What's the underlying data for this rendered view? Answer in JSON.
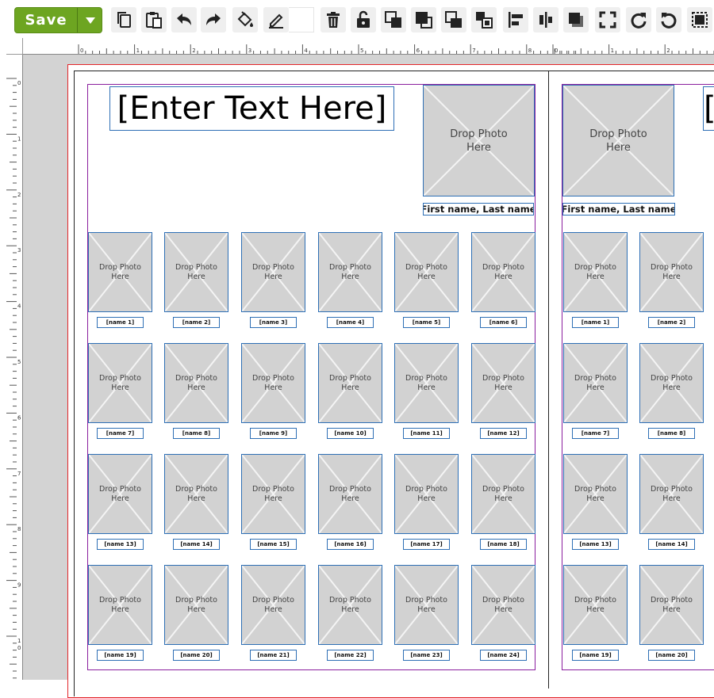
{
  "toolbar": {
    "save_label": "Save",
    "accent": "#6da521",
    "icons": [
      "copy-icon",
      "paste-icon",
      "undo-icon",
      "redo-icon",
      "fill-bucket-icon",
      "pen-icon",
      "delete-icon",
      "unlock-icon",
      "bring-forward-icon",
      "bring-to-front-icon",
      "send-backward-icon",
      "send-to-back-icon",
      "align-left-icon",
      "align-center-icon",
      "shadow-icon",
      "fit-frame-icon",
      "rotate-right-icon",
      "rotate-left-icon",
      "crop-icon"
    ]
  },
  "ruler": {
    "top_left_page": [
      "0",
      "1",
      "2",
      "3",
      "4",
      "5",
      "6",
      "7",
      "8"
    ],
    "top_right_page": [
      "0",
      "1",
      "2"
    ],
    "left": [
      "0",
      "1",
      "2",
      "3",
      "4",
      "5",
      "6",
      "7",
      "8",
      "9",
      "1\n0"
    ]
  },
  "page": {
    "title_placeholder": "[Enter Text Here]",
    "photo_placeholder": "Drop Photo\nHere",
    "featured_name": "[First name, Last name]",
    "left_names": [
      "[name 1]",
      "[name 2]",
      "[name 3]",
      "[name 4]",
      "[name 5]",
      "[name 6]",
      "[name 7]",
      "[name 8]",
      "[name 9]",
      "[name 10]",
      "[name 11]",
      "[name 12]",
      "[name 13]",
      "[name 14]",
      "[name 15]",
      "[name 16]",
      "[name 17]",
      "[name 18]",
      "[name 19]",
      "[name 20]",
      "[name 21]",
      "[name 22]",
      "[name 23]",
      "[name 24]"
    ],
    "right_names": [
      "[name 1]",
      "[name 2]",
      "[name 7]",
      "[name 8]",
      "[name 13]",
      "[name 14]",
      "[name 19]",
      "[name 20]"
    ]
  },
  "colors": {
    "bleed_line": "#e3262a",
    "safe_line": "#8b1f9e",
    "frame_border": "#2e6fb5",
    "placeholder_fill": "#d2d2d2",
    "canvas_bg": "#d3d3d3"
  }
}
